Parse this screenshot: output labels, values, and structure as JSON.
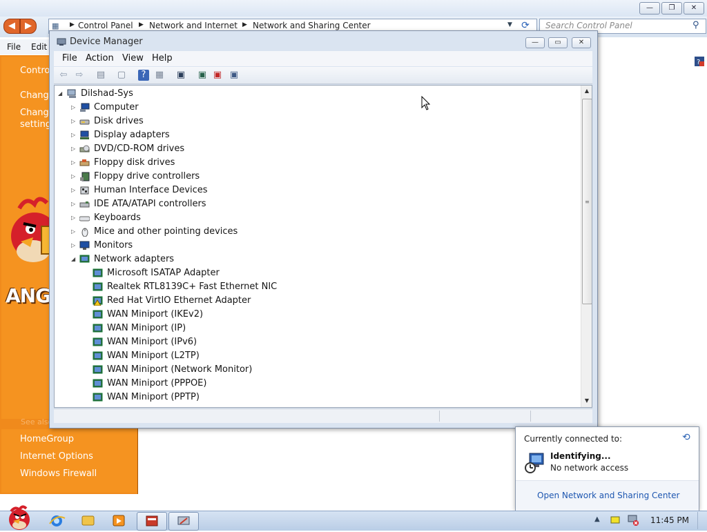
{
  "control_panel": {
    "breadcrumbs": [
      "Control Panel",
      "Network and Internet",
      "Network and Sharing Center"
    ],
    "search_placeholder": "Search Control Panel",
    "menu": [
      "File",
      "Edit"
    ],
    "sidebar_top_links": [
      "Control",
      "Change",
      "Change",
      "settings"
    ],
    "sidebar_bottom_links": [
      "HomeGroup",
      "Internet Options",
      "Windows Firewall"
    ],
    "see_also": "See also",
    "sidebar_art_text": "ANGR",
    "sidebar_color": "#f08a1c"
  },
  "device_manager": {
    "title": "Device Manager",
    "menu": [
      "File",
      "Action",
      "View",
      "Help"
    ],
    "root": "Dilshad-Sys",
    "categories": [
      {
        "label": "Computer",
        "icon": "computer-icon"
      },
      {
        "label": "Disk drives",
        "icon": "disk-drive-icon"
      },
      {
        "label": "Display adapters",
        "icon": "display-adapter-icon"
      },
      {
        "label": "DVD/CD-ROM drives",
        "icon": "dvd-drive-icon"
      },
      {
        "label": "Floppy disk drives",
        "icon": "floppy-drive-icon"
      },
      {
        "label": "Floppy drive controllers",
        "icon": "floppy-controller-icon"
      },
      {
        "label": "Human Interface Devices",
        "icon": "hid-icon"
      },
      {
        "label": "IDE ATA/ATAPI controllers",
        "icon": "ide-controller-icon"
      },
      {
        "label": "Keyboards",
        "icon": "keyboard-icon"
      },
      {
        "label": "Mice and other pointing devices",
        "icon": "mouse-icon"
      },
      {
        "label": "Monitors",
        "icon": "monitor-icon"
      },
      {
        "label": "Network adapters",
        "icon": "network-adapter-icon",
        "expanded": true
      }
    ],
    "network_adapters": [
      {
        "label": "Microsoft ISATAP Adapter",
        "warning": false
      },
      {
        "label": "Realtek RTL8139C+ Fast Ethernet NIC",
        "warning": false
      },
      {
        "label": "Red Hat VirtIO Ethernet Adapter",
        "warning": true
      },
      {
        "label": "WAN Miniport (IKEv2)",
        "warning": false
      },
      {
        "label": "WAN Miniport (IP)",
        "warning": false
      },
      {
        "label": "WAN Miniport (IPv6)",
        "warning": false
      },
      {
        "label": "WAN Miniport (L2TP)",
        "warning": false
      },
      {
        "label": "WAN Miniport (Network Monitor)",
        "warning": false
      },
      {
        "label": "WAN Miniport (PPPOE)",
        "warning": false
      },
      {
        "label": "WAN Miniport (PPTP)",
        "warning": false
      }
    ]
  },
  "network_flyout": {
    "header": "Currently connected to:",
    "network_name": "Identifying...",
    "network_status": "No network access",
    "link": "Open Network and Sharing Center"
  },
  "taskbar": {
    "clock": "11:45 PM"
  }
}
